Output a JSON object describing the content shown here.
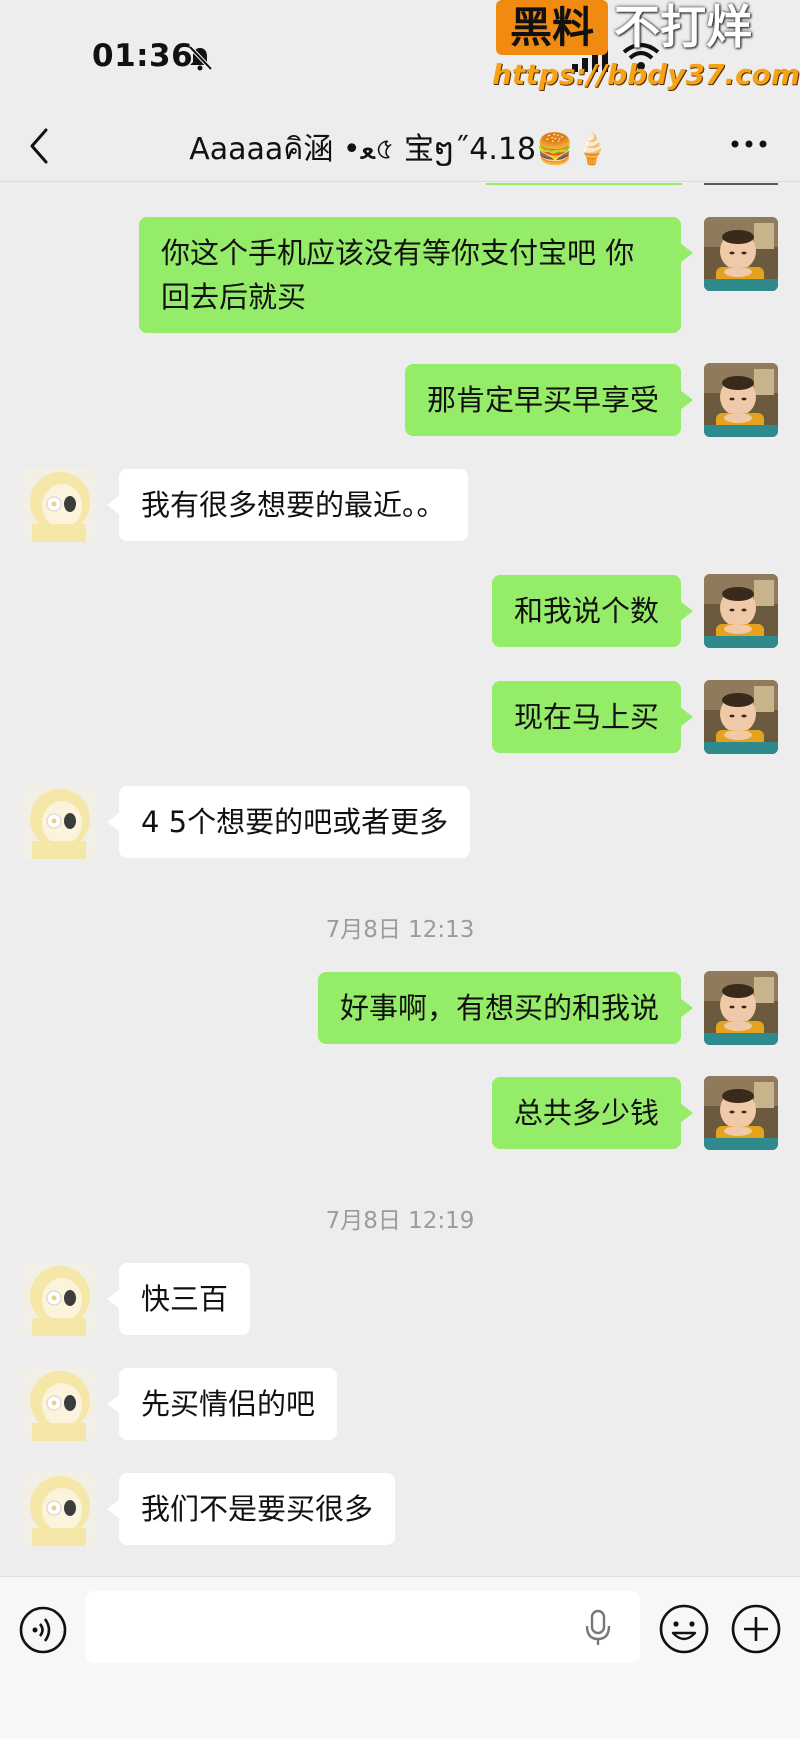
{
  "status_bar": {
    "time": "01:36",
    "icons": [
      "bell-mute-icon",
      "signal-icon",
      "wifi-icon"
    ]
  },
  "watermark": {
    "badge": "黑料",
    "title": "不打烊",
    "url": "https://bbdy37.com"
  },
  "nav": {
    "title": "Aaaaaคิ涵 •ﻌ৫ 宝ໆ˝4.18🍔🍦",
    "back_icon": "chevron-left-icon",
    "more_icon": "more-dots-icon"
  },
  "messages": [
    {
      "sender": "self",
      "text": "你这个手机应该没有等你支付宝吧 你回去后就买"
    },
    {
      "sender": "self",
      "text": "那肯定早买早享受"
    },
    {
      "sender": "other",
      "text": "我有很多想要的最近。。"
    },
    {
      "sender": "self",
      "text": "和我说个数"
    },
    {
      "sender": "self",
      "text": "现在马上买"
    },
    {
      "sender": "other",
      "text": "4 5个想要的吧或者更多"
    },
    {
      "timestamp": "7月8日 12:13"
    },
    {
      "sender": "self",
      "text": "好事啊，有想买的和我说"
    },
    {
      "sender": "self",
      "text": "总共多少钱"
    },
    {
      "timestamp": "7月8日 12:19"
    },
    {
      "sender": "other",
      "text": "快三百"
    },
    {
      "sender": "other",
      "text": "先买情侣的吧"
    },
    {
      "sender": "other",
      "text": "我们不是要买很多"
    }
  ],
  "input_bar": {
    "placeholder": "",
    "icons": [
      "voice-icon",
      "mic-icon",
      "emoji-icon",
      "plus-icon"
    ]
  },
  "colors": {
    "background": "#ededed",
    "self_bubble": "#95ec69",
    "other_bubble": "#ffffff",
    "timestamp": "#9b9b9b"
  }
}
